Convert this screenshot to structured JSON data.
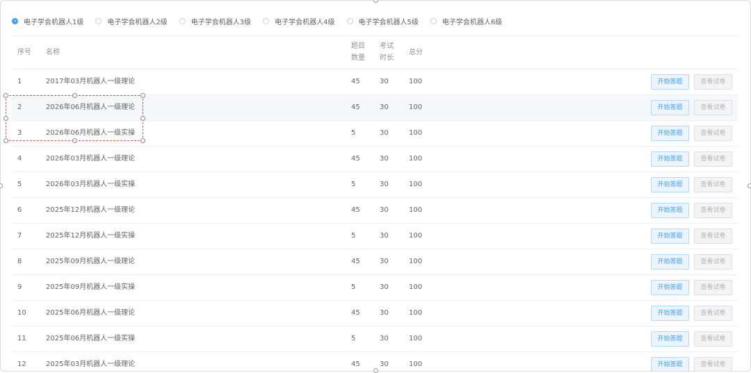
{
  "levels": [
    {
      "label": "电子学会机器人1级",
      "checked": true
    },
    {
      "label": "电子学会机器人2级",
      "checked": false
    },
    {
      "label": "电子学会机器人3级",
      "checked": false
    },
    {
      "label": "电子学会机器人4级",
      "checked": false
    },
    {
      "label": "电子学会机器人5级",
      "checked": false
    },
    {
      "label": "电子学会机器人6级",
      "checked": false
    }
  ],
  "table": {
    "headers": {
      "idx": "序号",
      "name": "名称",
      "questions_line1": "题目",
      "questions_line2": "数量",
      "time_line1": "考试",
      "time_line2": "时长",
      "score": "总分"
    },
    "start_label": "开始答题",
    "view_label": "查看试卷",
    "rows": [
      {
        "idx": "1",
        "name": "2017年03月机器人一级理论",
        "questions": "45",
        "time": "30",
        "score": "100"
      },
      {
        "idx": "2",
        "name": "2026年06月机器人一级理论",
        "questions": "45",
        "time": "30",
        "score": "100"
      },
      {
        "idx": "3",
        "name": "2026年06月机器人一级实操",
        "questions": "5",
        "time": "30",
        "score": "100"
      },
      {
        "idx": "4",
        "name": "2026年03月机器人一级理论",
        "questions": "45",
        "time": "30",
        "score": "100"
      },
      {
        "idx": "5",
        "name": "2026年03月机器人一级实操",
        "questions": "5",
        "time": "30",
        "score": "100"
      },
      {
        "idx": "6",
        "name": "2025年12月机器人一级理论",
        "questions": "45",
        "time": "30",
        "score": "100"
      },
      {
        "idx": "7",
        "name": "2025年12月机器人一级实操",
        "questions": "5",
        "time": "30",
        "score": "100"
      },
      {
        "idx": "8",
        "name": "2025年09月机器人一级理论",
        "questions": "45",
        "time": "30",
        "score": "100"
      },
      {
        "idx": "9",
        "name": "2025年09月机器人一级实操",
        "questions": "5",
        "time": "30",
        "score": "100"
      },
      {
        "idx": "10",
        "name": "2025年06月机器人一级理论",
        "questions": "45",
        "time": "30",
        "score": "100"
      },
      {
        "idx": "11",
        "name": "2025年06月机器人一级实操",
        "questions": "5",
        "time": "30",
        "score": "100"
      },
      {
        "idx": "12",
        "name": "2025年03月机器人一级理论",
        "questions": "45",
        "time": "30",
        "score": "100"
      }
    ]
  },
  "colors": {
    "accent": "#409eff",
    "start_bg": "#ecf5ff",
    "selection": "#d9534f"
  }
}
